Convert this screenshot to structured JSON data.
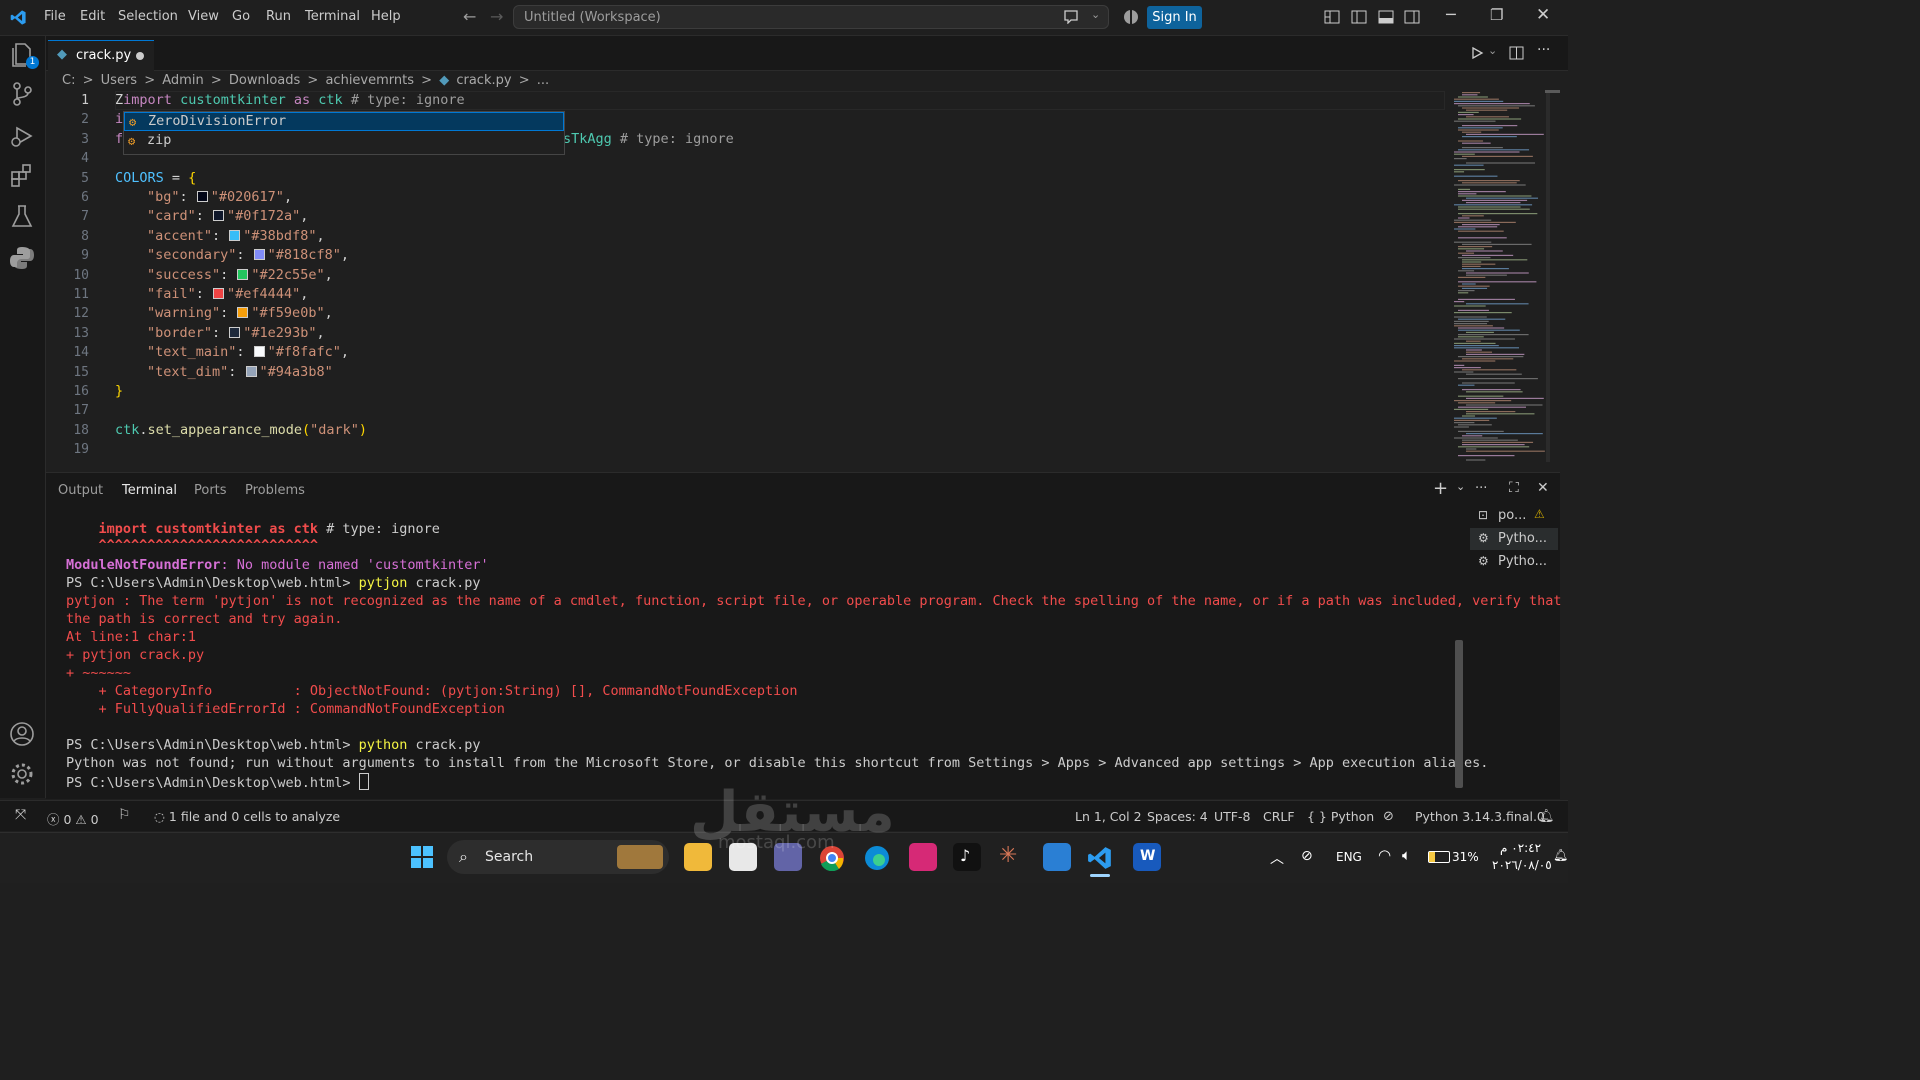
{
  "titlebar": {
    "menu": [
      "File",
      "Edit",
      "Selection",
      "View",
      "Go",
      "Run",
      "Terminal",
      "Help"
    ],
    "command_center": "Untitled (Workspace)",
    "signin": "Sign In"
  },
  "activity": {
    "explorer_badge": "1"
  },
  "tab": {
    "name": "crack.py"
  },
  "breadcrumb": [
    "C:",
    ">",
    "Users",
    ">",
    "Admin",
    ">",
    "Downloads",
    ">",
    "achievemrnts",
    ">",
    "crack.py",
    ">",
    "..."
  ],
  "editor": {
    "line_numbers": [
      "1",
      "2",
      "3",
      "4",
      "5",
      "6",
      "7",
      "8",
      "9",
      "10",
      "11",
      "12",
      "13",
      "14",
      "15",
      "16",
      "17",
      "18",
      "19"
    ],
    "line1": {
      "z": "Z",
      "import": "import",
      "module": "customtkinter",
      "as": "as",
      "alias": "ctk",
      "comment": "# type: ignore"
    },
    "line2": {
      "start": "i"
    },
    "line3": {
      "start": "f",
      "tail_cls": "sTkAgg",
      "comment": "# type: ignore"
    },
    "line5": {
      "name": "COLORS",
      "eq": " = ",
      "brace": "{"
    },
    "colors": [
      {
        "key": "\"bg\"",
        "value": "\"#020617\"",
        "swatch": "#020617"
      },
      {
        "key": "\"card\"",
        "value": "\"#0f172a\"",
        "swatch": "#0f172a"
      },
      {
        "key": "\"accent\"",
        "value": "\"#38bdf8\"",
        "swatch": "#38bdf8"
      },
      {
        "key": "\"secondary\"",
        "value": "\"#818cf8\"",
        "swatch": "#818cf8"
      },
      {
        "key": "\"success\"",
        "value": "\"#22c55e\"",
        "swatch": "#22c55e"
      },
      {
        "key": "\"fail\"",
        "value": "\"#ef4444\"",
        "swatch": "#ef4444"
      },
      {
        "key": "\"warning\"",
        "value": "\"#f59e0b\"",
        "swatch": "#f59e0b"
      },
      {
        "key": "\"border\"",
        "value": "\"#1e293b\"",
        "swatch": "#1e293b"
      },
      {
        "key": "\"text_main\"",
        "value": "\"#f8fafc\"",
        "swatch": "#f8fafc"
      },
      {
        "key": "\"text_dim\"",
        "value": "\"#94a3b8\"",
        "swatch": "#94a3b8"
      }
    ],
    "line16": "}",
    "line18": {
      "obj": "ctk",
      "fn": "set_appearance_mode",
      "arg": "\"dark\""
    },
    "suggestions": [
      "ZeroDivisionError",
      "zip"
    ]
  },
  "panel": {
    "tabs": [
      "Output",
      "Terminal",
      "Ports",
      "Problems"
    ],
    "terminals": [
      "po...",
      "Pytho...",
      "Pytho..."
    ]
  },
  "terminal": {
    "l1_import": "import customtkinter as ctk",
    "l1_rest": " # type: ignore",
    "l2": "^^^^^^^^^^^^^^^^^^^^^^^^^^^",
    "l3_err": "ModuleNotFoundError",
    "l3_msg": ": No module named 'customtkinter'",
    "l4_prompt": "PS C:\\Users\\Admin\\Desktop\\web.html> ",
    "l4_cmd": "pytjon",
    "l4_arg": " crack.py",
    "l5": "pytjon : The term 'pytjon' is not recognized as the name of a cmdlet, function, script file, or operable program. Check the spelling of the name, or if a path was included, verify that",
    "l6": "the path is correct and try again.",
    "l7": "At line:1 char:1",
    "l8": "+ pytjon crack.py",
    "l9": "+ ~~~~~~",
    "l10": "    + CategoryInfo          : ObjectNotFound: (pytjon:String) [], CommandNotFoundException",
    "l11": "    + FullyQualifiedErrorId : CommandNotFoundException",
    "l13_prompt": "PS C:\\Users\\Admin\\Desktop\\web.html> ",
    "l13_cmd": "python",
    "l13_arg": " crack.py",
    "l14": "Python was not found; run without arguments to install from the Microsoft Store, or disable this shortcut from Settings > Apps > Advanced app settings > App execution aliases.",
    "l15_prompt": "PS C:\\Users\\Admin\\Desktop\\web.html> "
  },
  "status": {
    "errors": "0",
    "warnings": "0",
    "analyze": "1 file and 0 cells to analyze",
    "position": "Ln 1, Col 2",
    "spaces": "Spaces: 4",
    "encoding": "UTF-8",
    "eol": "CRLF",
    "language": "Python",
    "interpreter": "Python 3.14.3.final.0"
  },
  "taskbar": {
    "search": "Search",
    "lang": "ENG",
    "battery": "31%",
    "time": "٠٢:٤٢ م",
    "date": "٢٠٢٦/٠٨/٠٥"
  },
  "watermark": {
    "arabic": "مستقل",
    "latin": "mostaql.com"
  }
}
